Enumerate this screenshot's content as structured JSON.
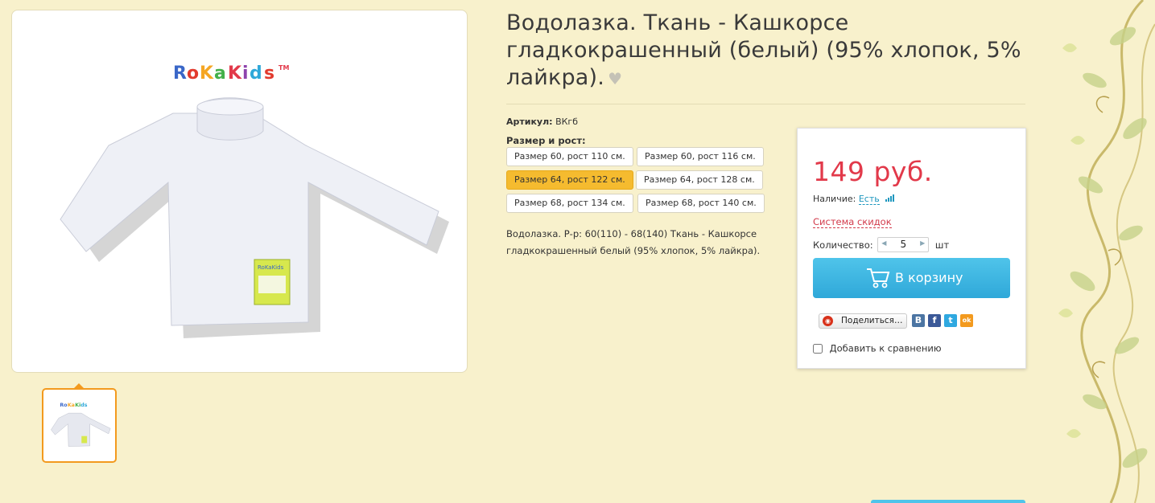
{
  "product": {
    "title": "Водолазка. Ткань - Кашкорсе гладкокрашенный (белый) (95% хлопок, 5% лайкра).",
    "article_label": "Артикул:",
    "article_value": "ВКгб",
    "size_label": "Размер и рост:",
    "sizes": [
      "Размер 60, рост 110 см.",
      "Размер 60, рост 116 см.",
      "Размер 64, рост 122 см.",
      "Размер 64, рост 128 см.",
      "Размер 68, рост 134 см.",
      "Размер 68, рост 140 см."
    ],
    "selected_size_index": 2,
    "description_line1": "Водолазка. Р-р: 60(110) - 68(140) Ткань - Кашкорсе",
    "description_line2": "гладкокрашенный белый  (95% хлопок, 5% лайкра).",
    "brand_logo_text": "RoKaKids",
    "brand_tm": "TM"
  },
  "buybox": {
    "price": "149 руб.",
    "stock_label": "Наличие:",
    "stock_value": "Есть",
    "discount_link": "Система скидок",
    "quantity_label": "Количество:",
    "quantity_value": "5",
    "quantity_unit": "шт",
    "cart_button": "В корзину",
    "share_button": "Поделиться…",
    "social": [
      "В",
      "f",
      "t",
      "ok"
    ],
    "compare_label": "Добавить к сравнению"
  },
  "colors": {
    "background": "#f8f1cc",
    "price": "#e2394a",
    "accent": "#2fa8d9",
    "selected_size": "#f5bb2f",
    "thumb_border": "#f39a1e"
  }
}
